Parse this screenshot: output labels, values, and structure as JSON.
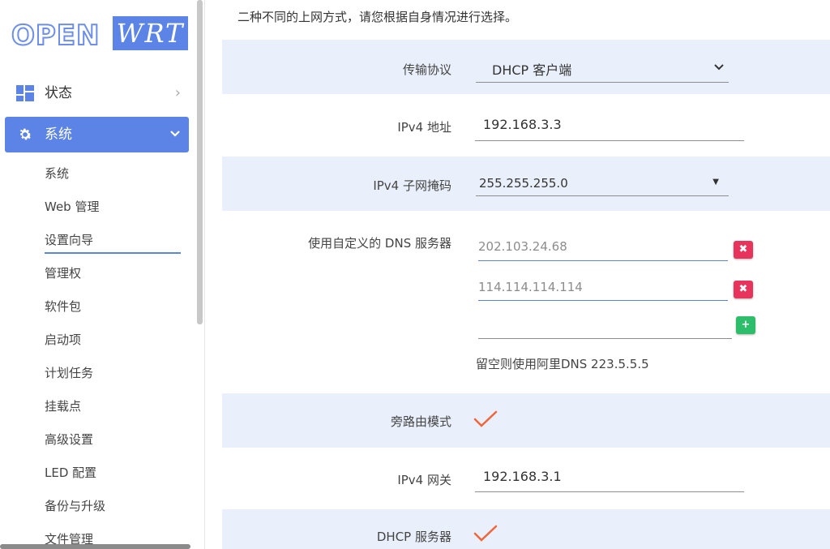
{
  "logo": {
    "left_text": "OPEN",
    "right_text": "WRT"
  },
  "sidebar": {
    "top_items": [
      {
        "label": "状态",
        "icon": "dashboard-icon",
        "chevron": "›"
      },
      {
        "label": "系统",
        "icon": "gear-icon",
        "chevron": "⌄"
      }
    ],
    "sub_items": [
      "系统",
      "Web 管理",
      "设置向导",
      "管理权",
      "软件包",
      "启动项",
      "计划任务",
      "挂载点",
      "高级设置",
      "LED 配置",
      "备份与升级",
      "文件管理"
    ],
    "active_sub": "设置向导"
  },
  "main": {
    "intro": "二种不同的上网方式，请您根据自身情况进行选择。",
    "protocol": {
      "label": "传输协议",
      "value": "DHCP 客户端"
    },
    "ipv4_addr": {
      "label": "IPv4 地址",
      "value": "192.168.3.3"
    },
    "netmask": {
      "label": "IPv4 子网掩码",
      "value": "255.255.255.0"
    },
    "dns": {
      "label": "使用自定义的 DNS 服务器",
      "entries": [
        "202.103.24.68",
        "114.114.114.114"
      ],
      "new_entry": "",
      "delete_symbol": "✖",
      "add_symbol": "+",
      "hint": "留空则使用阿里DNS 223.5.5.5"
    },
    "bypass": {
      "label": "旁路由模式",
      "checked": true
    },
    "gateway": {
      "label": "IPv4 网关",
      "value": "192.168.3.1"
    },
    "dhcp_server": {
      "label": "DHCP 服务器",
      "checked": true
    }
  },
  "colors": {
    "accent": "#5b84e6",
    "row_shade": "#eaf0fb",
    "delete": "#e8345c",
    "add": "#2ebd6b",
    "check": "#f0663a"
  }
}
